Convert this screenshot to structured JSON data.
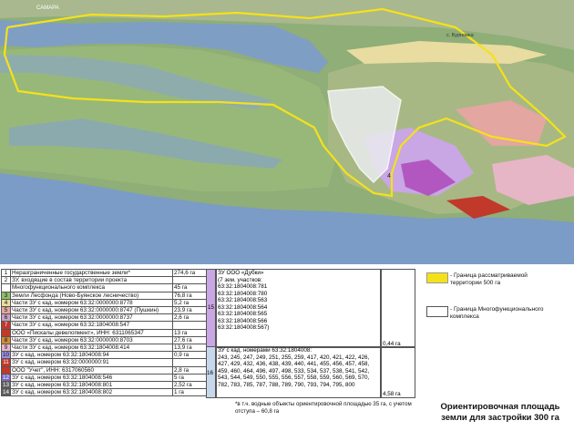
{
  "map": {
    "village_label_top": "САМАРА",
    "village_label_right": "с. Бурновка",
    "plot_number_label": "4"
  },
  "table_left": {
    "rows": [
      {
        "num": "1",
        "name": "Неразграниченные государственные земли*",
        "area": "274,6 га",
        "color": "#ffffff"
      },
      {
        "num": "2",
        "name": "ЗУ, входящие в состав территории проекта",
        "area": "",
        "color": "#ffffff"
      },
      {
        "num": "",
        "name": "Многофункционального комплекса",
        "area": "45 га",
        "color": "#ffffff"
      },
      {
        "num": "3",
        "name": "Земли Лесфонда (Ново-Буянское лесничество)",
        "area": "76,8 га",
        "color": "#8ac16a"
      },
      {
        "num": "4",
        "name": "Части ЗУ с кад. номером 63:32:0000000:8778",
        "area": "5,2 га",
        "color": "#e8dca0"
      },
      {
        "num": "5",
        "name": "Части ЗУ с кад. номером 63:32:0000000:8747 (Пушкин)",
        "area": "23,9 га",
        "color": "#e3a6a0"
      },
      {
        "num": "6",
        "name": "Части ЗУ с кад. номером 63:32:0000000:8737",
        "area": "2,6 га",
        "color": "#c6a0c6"
      },
      {
        "num": "7",
        "name": "Части ЗУ с кад. номером 63:32:1804008:547",
        "area": "",
        "color": "#c0392b"
      },
      {
        "num": "",
        "name": "ООО «Пискалы девелопмент», ИНН: 6311065347",
        "area": "13 га",
        "color": "#c0392b"
      },
      {
        "num": "8",
        "name": "Части ЗУ с кад. номером 63:32:0000000:8703",
        "area": "27,6 га",
        "color": "#d48a3a"
      },
      {
        "num": "9",
        "name": "Части ЗУ с кад. номером 63:32:1804008:414",
        "area": "13,9 га",
        "color": "#e6b6c6"
      },
      {
        "num": "10",
        "name": "ЗУ с кад. номером 63:32:1804008:94",
        "area": "0,9 га",
        "color": "#9a8ee0"
      },
      {
        "num": "11",
        "name": "ЗУ с кад. номером 63:32:0000000:91",
        "area": "",
        "color": "#c0392b"
      },
      {
        "num": "",
        "name": "ООО \"Учет\", ИНН: 6317060560",
        "area": "2,8 га",
        "color": "#c0392b"
      },
      {
        "num": "12",
        "name": "ЗУ с кад. номером 63:32:1804008:546",
        "area": "5 га",
        "color": "#7a6ac4"
      },
      {
        "num": "13",
        "name": "ЗУ с кад. номером 63:32:1804008:801",
        "area": "2,52 га",
        "color": "#5d5d5d"
      },
      {
        "num": "14",
        "name": "ЗУ с кад. номером 63:32:1804008:802",
        "area": "1 га",
        "color": "#5d5d5d"
      }
    ]
  },
  "table_mid": {
    "row15": {
      "num": "15",
      "lines": [
        "ЗУ ООО «Дубки»",
        "(7 зем. участков:",
        "63:32:1804008:781",
        "63:32:1804008:780",
        "63:32:1804008:563",
        "63:32:1804008:564",
        "63:32:1804008:565",
        "63:32:1804008:566",
        "63:32:1804008:567)"
      ],
      "area": "0,44 га",
      "color": "#c9a6e4"
    },
    "row16": {
      "num": "16",
      "lines": [
        "ЗУ с кад. номерами 63:32:1804008:",
        "243, 245, 247, 249, 251, 255, 259, 417, 420, 421, 422, 426,",
        "427, 429, 432, 436, 438, 439, 440, 441, 455, 456, 457, 458,",
        "459, 460, 464, 496, 497, 498, 533, 534, 537, 538, 541, 542,",
        "543, 544, 549, 550, 555, 556, 557, 558, 559, 560, 569, 570,",
        "782, 783, 785, 787, 788, 789, 790, 793, 794, 795, 800"
      ],
      "area": "4,58 га",
      "color": "#c6d8ec"
    }
  },
  "legend": {
    "yellow_label_1": "- Граница рассматриваемой",
    "yellow_label_2": "территории 500 га",
    "white_label_1": "- Граница Многофункционального",
    "white_label_2": "комплекса",
    "yellow_color": "#f5e11a",
    "white_color": "#ffffff"
  },
  "footnote": {
    "line1": "*в т.ч. водные объекты ориентировочной площадью 35 га, с учетом",
    "line2": "отступа – 60,8 га"
  },
  "summary": {
    "line1": "Ориентировочная площадь",
    "line2": "земли для застройки 300 га"
  }
}
